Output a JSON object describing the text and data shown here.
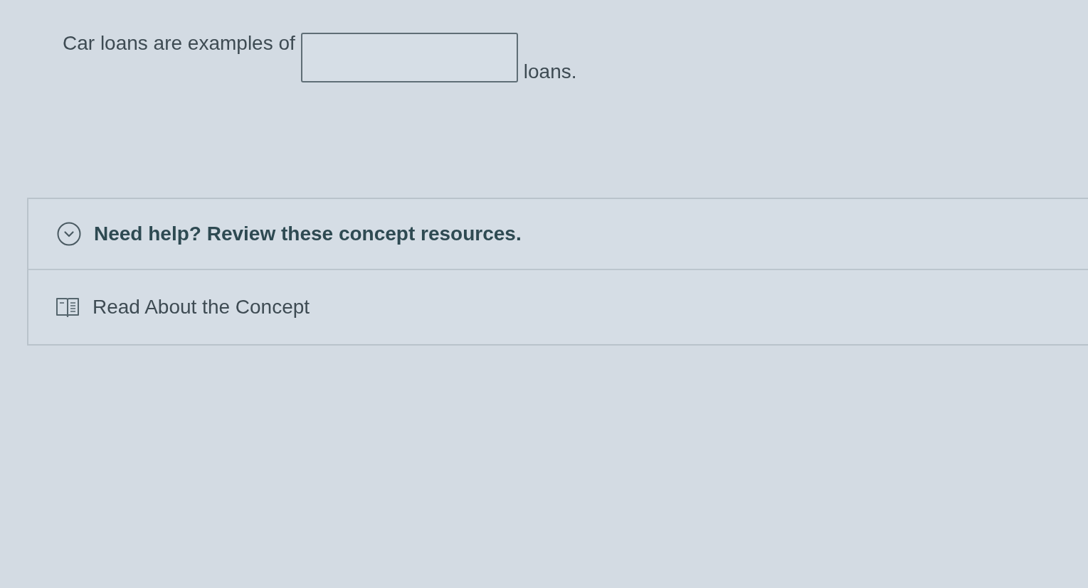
{
  "question": {
    "parts": [
      {
        "kind": "text",
        "text": "Car loans are examples of"
      },
      {
        "kind": "blank"
      },
      {
        "kind": "text",
        "text": "loans."
      }
    ]
  },
  "help_panel": {
    "title": "Need help? Review these concept resources.",
    "expanded": true,
    "resources": [
      {
        "kind": "reading",
        "label": "Read About the Concept"
      }
    ]
  }
}
